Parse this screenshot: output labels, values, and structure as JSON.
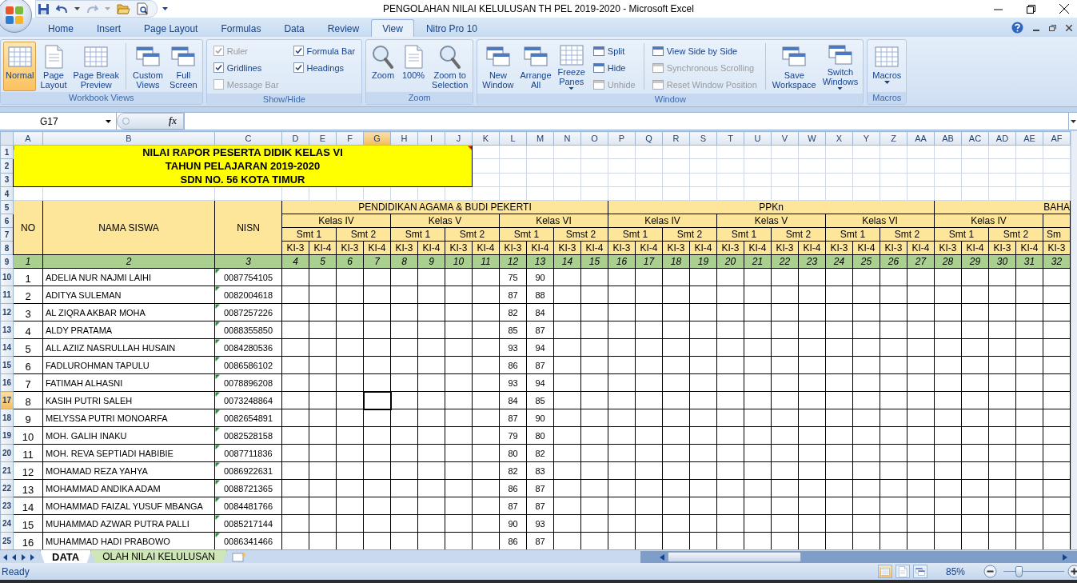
{
  "window": {
    "title": "PENGOLAHAN NILAI KELULUSAN TH PEL 2019-2020 - Microsoft Excel"
  },
  "tabs": [
    {
      "label": "Home",
      "selected": false
    },
    {
      "label": "Insert",
      "selected": false
    },
    {
      "label": "Page Layout",
      "selected": false
    },
    {
      "label": "Formulas",
      "selected": false
    },
    {
      "label": "Data",
      "selected": false
    },
    {
      "label": "Review",
      "selected": false
    },
    {
      "label": "View",
      "selected": true
    },
    {
      "label": "Nitro Pro 10",
      "selected": false
    }
  ],
  "ribbon_groups": [
    {
      "label": "Workbook Views",
      "items": [
        {
          "kind": "large",
          "label": [
            "Normal"
          ],
          "selected": true
        },
        {
          "kind": "large",
          "label": [
            "Page",
            "Layout"
          ],
          "selected": false
        },
        {
          "kind": "large",
          "label": [
            "Page Break",
            "Preview"
          ],
          "selected": false
        },
        {
          "kind": "divider"
        },
        {
          "kind": "large",
          "label": [
            "Custom",
            "Views"
          ],
          "selected": false
        },
        {
          "kind": "large",
          "label": [
            "Full",
            "Screen"
          ],
          "selected": false
        }
      ]
    },
    {
      "label": "Show/Hide",
      "items": [
        {
          "kind": "checkbox",
          "label": "Ruler",
          "checked": true,
          "disabled": true
        },
        {
          "kind": "checkbox",
          "label": "Gridlines",
          "checked": true,
          "disabled": false
        },
        {
          "kind": "checkbox",
          "label": "Message Bar",
          "checked": false,
          "disabled": true
        },
        {
          "kind": "checkbox",
          "label": "Formula Bar",
          "checked": true,
          "disabled": false
        },
        {
          "kind": "checkbox",
          "label": "Headings",
          "checked": true,
          "disabled": false
        }
      ]
    },
    {
      "label": "Zoom",
      "items": [
        {
          "kind": "large",
          "label": [
            "Zoom"
          ],
          "selected": false
        },
        {
          "kind": "large",
          "label": [
            "100%"
          ],
          "selected": false
        },
        {
          "kind": "large",
          "label": [
            "Zoom to",
            "Selection"
          ],
          "selected": false
        }
      ]
    },
    {
      "label": "Window",
      "items": [
        {
          "kind": "large",
          "label": [
            "New",
            "Window"
          ],
          "selected": false
        },
        {
          "kind": "large",
          "label": [
            "Arrange",
            "All"
          ],
          "selected": false
        },
        {
          "kind": "large",
          "label": [
            "Freeze",
            "Panes"
          ],
          "selected": false,
          "dropdown": true
        },
        {
          "kind": "small",
          "label": "Split",
          "disabled": false
        },
        {
          "kind": "small",
          "label": "Hide",
          "disabled": false
        },
        {
          "kind": "small",
          "label": "Unhide",
          "disabled": true
        },
        {
          "kind": "divider"
        },
        {
          "kind": "small",
          "label": "View Side by Side",
          "disabled": false
        },
        {
          "kind": "small",
          "label": "Synchronous Scrolling",
          "disabled": true
        },
        {
          "kind": "small",
          "label": "Reset Window Position",
          "disabled": true
        },
        {
          "kind": "divider"
        },
        {
          "kind": "large",
          "label": [
            "Save",
            "Workspace"
          ],
          "selected": false
        },
        {
          "kind": "large",
          "label": [
            "Switch",
            "Windows"
          ],
          "selected": false,
          "dropdown": true
        }
      ]
    },
    {
      "label": "Macros",
      "items": [
        {
          "kind": "large",
          "label": [
            "Macros"
          ],
          "selected": false,
          "dropdown": true
        }
      ]
    }
  ],
  "formula_bar": {
    "name_box": "G17",
    "function_label": "fx"
  },
  "sheet": {
    "columns": [
      {
        "label": "A",
        "selected": false
      },
      {
        "label": "B",
        "selected": false
      },
      {
        "label": "C",
        "selected": false
      },
      {
        "label": "D",
        "selected": false
      },
      {
        "label": "E",
        "selected": false
      },
      {
        "label": "F",
        "selected": false
      },
      {
        "label": "G",
        "selected": true
      },
      {
        "label": "H",
        "selected": false
      },
      {
        "label": "I",
        "selected": false
      },
      {
        "label": "J",
        "selected": false
      },
      {
        "label": "K",
        "selected": false
      },
      {
        "label": "L",
        "selected": false
      },
      {
        "label": "M",
        "selected": false
      },
      {
        "label": "N",
        "selected": false
      },
      {
        "label": "O",
        "selected": false
      },
      {
        "label": "P",
        "selected": false
      },
      {
        "label": "Q",
        "selected": false
      },
      {
        "label": "R",
        "selected": false
      },
      {
        "label": "S",
        "selected": false
      },
      {
        "label": "T",
        "selected": false
      },
      {
        "label": "U",
        "selected": false
      },
      {
        "label": "V",
        "selected": false
      },
      {
        "label": "W",
        "selected": false
      },
      {
        "label": "X",
        "selected": false
      },
      {
        "label": "Y",
        "selected": false
      },
      {
        "label": "Z",
        "selected": false
      },
      {
        "label": "AA",
        "selected": false
      },
      {
        "label": "AB",
        "selected": false
      },
      {
        "label": "AC",
        "selected": false
      },
      {
        "label": "AD",
        "selected": false
      },
      {
        "label": "AE",
        "selected": false
      },
      {
        "label": "AF",
        "selected": false
      }
    ],
    "rows": [
      {
        "label": "1",
        "selected": false
      },
      {
        "label": "2",
        "selected": false
      },
      {
        "label": "3",
        "selected": false
      },
      {
        "label": "4",
        "selected": false
      },
      {
        "label": "5",
        "selected": false
      },
      {
        "label": "6",
        "selected": false
      },
      {
        "label": "7",
        "selected": false
      },
      {
        "label": "8",
        "selected": false
      },
      {
        "label": "9",
        "selected": false
      },
      {
        "label": "10",
        "selected": false
      },
      {
        "label": "11",
        "selected": false
      },
      {
        "label": "12",
        "selected": false
      },
      {
        "label": "13",
        "selected": false
      },
      {
        "label": "14",
        "selected": false
      },
      {
        "label": "15",
        "selected": false
      },
      {
        "label": "16",
        "selected": false
      },
      {
        "label": "17",
        "selected": true
      },
      {
        "label": "18",
        "selected": false
      },
      {
        "label": "19",
        "selected": false
      },
      {
        "label": "20",
        "selected": false
      },
      {
        "label": "21",
        "selected": false
      },
      {
        "label": "22",
        "selected": false
      },
      {
        "label": "23",
        "selected": false
      },
      {
        "label": "24",
        "selected": false
      },
      {
        "label": "25",
        "selected": false
      }
    ],
    "banner": [
      "NILAI RAPOR PESERTA DIDIK KELAS VI",
      "TAHUN PELAJARAN 2019-2020",
      "SDN NO. 56 KOTA TIMUR"
    ],
    "header": {
      "no": "NO",
      "name": "NAMA SISWA",
      "nisn": "NISN",
      "subjects": [
        {
          "name": "PENDIDIKAN AGAMA & BUDI PEKERTI",
          "classes": [
            {
              "name": "Kelas IV",
              "semesters": [
                {
                  "name": "Smt 1",
                  "ki": [
                    "KI-3",
                    "KI-4"
                  ]
                },
                {
                  "name": "Smt 2",
                  "ki": [
                    "KI-3",
                    "KI-4"
                  ]
                }
              ]
            },
            {
              "name": "Kelas V",
              "semesters": [
                {
                  "name": "Smt 1",
                  "ki": [
                    "KI-3",
                    "KI-4"
                  ]
                },
                {
                  "name": "Smt 2",
                  "ki": [
                    "KI-3",
                    "KI-4"
                  ]
                }
              ]
            },
            {
              "name": "Kelas VI",
              "semesters": [
                {
                  "name": "Smt 1",
                  "ki": [
                    "KI-3",
                    "KI-4"
                  ]
                },
                {
                  "name": "Smst 2",
                  "ki": [
                    "KI-3",
                    "KI-4"
                  ]
                }
              ]
            }
          ]
        },
        {
          "name": "PPKn",
          "classes": [
            {
              "name": "Kelas IV",
              "semesters": [
                {
                  "name": "Smt 1",
                  "ki": [
                    "KI-3",
                    "KI-4"
                  ]
                },
                {
                  "name": "Smt 2",
                  "ki": [
                    "KI-3",
                    "KI-4"
                  ]
                }
              ]
            },
            {
              "name": "Kelas V",
              "semesters": [
                {
                  "name": "Smt 1",
                  "ki": [
                    "KI-3",
                    "KI-4"
                  ]
                },
                {
                  "name": "Smt 2",
                  "ki": [
                    "KI-3",
                    "KI-4"
                  ]
                }
              ]
            },
            {
              "name": "Kelas VI",
              "semesters": [
                {
                  "name": "Smt 1",
                  "ki": [
                    "KI-3",
                    "KI-4"
                  ]
                },
                {
                  "name": "Smt 2",
                  "ki": [
                    "KI-3",
                    "KI-4"
                  ]
                }
              ]
            }
          ]
        },
        {
          "name": "BAHA",
          "classes": [
            {
              "name": "Kelas IV",
              "semesters": [
                {
                  "name": "Smt 1",
                  "ki": [
                    "KI-3",
                    "KI-4"
                  ]
                },
                {
                  "name": "Smt 2",
                  "ki": [
                    "KI-3",
                    "KI-4"
                  ]
                }
              ]
            },
            {
              "semesters": [
                {
                  "name": "Sm",
                  "ki": [
                    "KI-3"
                  ]
                }
              ]
            }
          ]
        }
      ],
      "column_numbers": [
        "1",
        "2",
        "3",
        "4",
        "5",
        "6",
        "7",
        "8",
        "9",
        "10",
        "11",
        "12",
        "13",
        "14",
        "15",
        "16",
        "17",
        "18",
        "19",
        "20",
        "21",
        "22",
        "23",
        "24",
        "25",
        "26",
        "27",
        "28",
        "29",
        "30",
        "31",
        "32"
      ]
    },
    "students": [
      {
        "no": "1",
        "name": "ADELIA NUR NAJMI LAIHI",
        "nisn": "0087754105",
        "scores": [
          "75",
          "90"
        ]
      },
      {
        "no": "2",
        "name": "ADITYA SULEMAN",
        "nisn": "0082004618",
        "scores": [
          "87",
          "88"
        ]
      },
      {
        "no": "3",
        "name": "AL ZIQRA AKBAR MOHA",
        "nisn": "0087257226",
        "scores": [
          "82",
          "84"
        ]
      },
      {
        "no": "4",
        "name": "ALDY PRATAMA",
        "nisn": "0088355850",
        "scores": [
          "85",
          "87"
        ]
      },
      {
        "no": "5",
        "name": "ALL AZIIZ NASRULLAH HUSAIN",
        "nisn": "0084280536",
        "scores": [
          "93",
          "94"
        ]
      },
      {
        "no": "6",
        "name": "FADLUROHMAN TAPULU",
        "nisn": "0086586102",
        "scores": [
          "86",
          "87"
        ]
      },
      {
        "no": "7",
        "name": "FATIMAH ALHASNI",
        "nisn": "0078896208",
        "scores": [
          "93",
          "94"
        ]
      },
      {
        "no": "8",
        "name": "KASIH PUTRI SALEH",
        "nisn": "0073248864",
        "scores": [
          "84",
          "85"
        ]
      },
      {
        "no": "9",
        "name": "MELYSSA PUTRI MONOARFA",
        "nisn": "0082654891",
        "scores": [
          "87",
          "90"
        ]
      },
      {
        "no": "10",
        "name": "MOH. GALIH INAKU",
        "nisn": "0082528158",
        "scores": [
          "79",
          "80"
        ]
      },
      {
        "no": "11",
        "name": "MOH. REVA SEPTIADI HABIBIE",
        "nisn": "0087711836",
        "scores": [
          "80",
          "82"
        ]
      },
      {
        "no": "12",
        "name": "MOHAMAD REZA YAHYA",
        "nisn": "0086922631",
        "scores": [
          "82",
          "83"
        ]
      },
      {
        "no": "13",
        "name": "MOHAMMAD ANDIKA ADAM",
        "nisn": "0088721365",
        "scores": [
          "86",
          "87"
        ]
      },
      {
        "no": "14",
        "name": "MOHAMMAD FAIZAL YUSUF MBANGA",
        "nisn": "0084481766",
        "scores": [
          "87",
          "87"
        ]
      },
      {
        "no": "15",
        "name": "MUHAMMAD AZWAR PUTRA PALLI",
        "nisn": "0085217144",
        "scores": [
          "90",
          "93"
        ]
      },
      {
        "no": "16",
        "name": "MUHAMMAD HADI PRABOWO",
        "nisn": "0086341466",
        "scores": [
          "86",
          "87"
        ]
      }
    ]
  },
  "sheet_tabs": [
    {
      "label": "DATA",
      "selected": true
    },
    {
      "label": "OLAH NILAI KELULUSAN",
      "selected": false
    }
  ],
  "status_bar": {
    "text": "Ready",
    "views": [
      {
        "selected": true
      },
      {
        "selected": false
      },
      {
        "selected": false
      }
    ],
    "zoom": "85%",
    "zoom_slider": {
      "level": 0.25
    }
  }
}
